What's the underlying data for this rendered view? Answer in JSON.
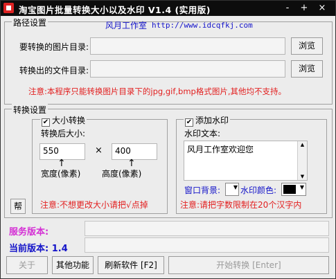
{
  "window": {
    "title": "淘宝图片批量转换大小以及水印 V1.4 (实用版)"
  },
  "titlebar": {
    "min": "-",
    "max": "+",
    "close": "×"
  },
  "path_group": {
    "legend": "路径设置",
    "studio": "风月工作室",
    "url": "http://www.idcqfkj.com",
    "src_label": "要转换的图片目录:",
    "src_value": "",
    "out_label": "转换出的文件目录:",
    "out_value": "",
    "browse1": "浏览",
    "browse2": "浏览",
    "note": "注意:本程序只能转换图片目录下的jpg,gif,bmp格式图片,其他均不支持。"
  },
  "convert_group": {
    "legend": "转换设置",
    "help_button": "帮",
    "resize": {
      "legend": "大小转换",
      "checked": true,
      "size_label": "转换后大小:",
      "width_value": "550",
      "times": "×",
      "height_value": "400",
      "width_label": "宽度(像素)",
      "height_label": "高度(像素)",
      "note": "注意:不想更改大小请把√点掉"
    },
    "watermark": {
      "legend": "添加水印",
      "checked": true,
      "text_label": "水印文本:",
      "text_value": "风月工作室欢迎您",
      "bg_label": "窗口背景:",
      "color_label": "水印颜色:",
      "bg_color": "#ffffff",
      "wm_color": "#000000",
      "note": "注意:请把字数限制在20个汉字内"
    }
  },
  "status": {
    "server_label": "服务版本:",
    "server_value": "",
    "current_label": "当前版本:",
    "current_value": "1.4",
    "server_color": "#d42fd4",
    "current_color": "#1313c9"
  },
  "buttons": {
    "about": "关于",
    "other": "其他功能",
    "refresh": "刷新软件 [F2]",
    "start": "开始转换 [Enter]"
  }
}
